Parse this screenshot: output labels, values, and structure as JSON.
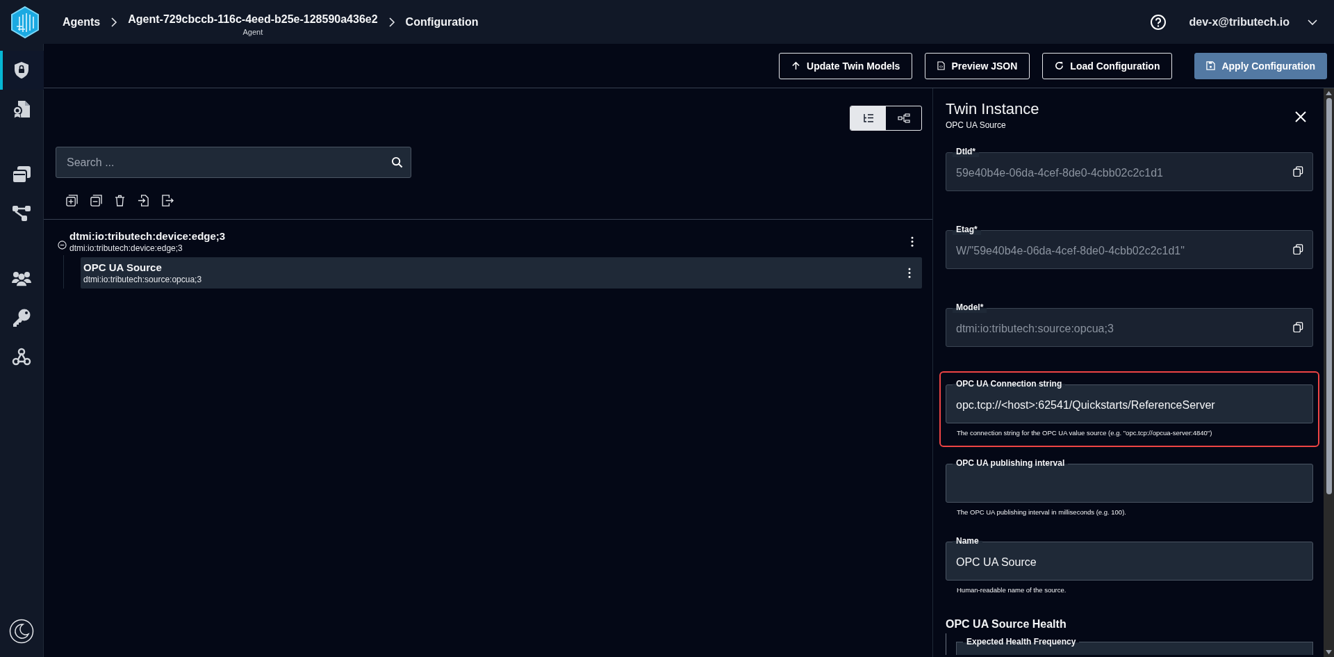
{
  "header": {
    "breadcrumbs": [
      {
        "label": "Agents"
      },
      {
        "label": "Agent-729cbccb-116c-4eed-b25e-128590a436e2",
        "sublabel": "Agent"
      },
      {
        "label": "Configuration"
      }
    ],
    "user": "dev-x@tributech.io"
  },
  "sidebar": {
    "items": [
      {
        "kind": "shield-lock",
        "selected": true
      },
      {
        "kind": "certificate",
        "selected": false
      },
      {
        "kind": "windows",
        "selected": false
      },
      {
        "kind": "hierarchy",
        "selected": false
      },
      {
        "kind": "users",
        "selected": false
      },
      {
        "kind": "key",
        "selected": false
      },
      {
        "kind": "webhook",
        "selected": false
      }
    ]
  },
  "toolbar": {
    "buttons": [
      {
        "label": "Update Twin Models",
        "kind": "upload",
        "primary": false
      },
      {
        "label": "Preview JSON",
        "kind": "file-code",
        "primary": false
      },
      {
        "label": "Load Configuration",
        "kind": "reload",
        "primary": false
      },
      {
        "label": "Apply Configuration",
        "kind": "save",
        "primary": true
      }
    ]
  },
  "view_toggle": [
    {
      "kind": "tree",
      "selected": true
    },
    {
      "kind": "diagram",
      "selected": false
    }
  ],
  "search": {
    "placeholder": "Search ..."
  },
  "tree_actions": [
    {
      "kind": "expand-all"
    },
    {
      "kind": "collapse-all"
    },
    {
      "kind": "delete"
    },
    {
      "kind": "import"
    },
    {
      "kind": "export"
    }
  ],
  "tree": [
    {
      "title": "dtmi:io:tributech:device:edge;3",
      "subtitle": "dtmi:io:tributech:device:edge;3",
      "expanded": true,
      "selected": false,
      "children": [
        {
          "title": "OPC UA Source",
          "subtitle": "dtmi:io:tributech:source:opcua;3",
          "selected": true
        }
      ]
    }
  ],
  "panel": {
    "title": "Twin Instance",
    "subtitle": "OPC UA Source",
    "fields": [
      {
        "label": "DtId*",
        "value": "59e40b4e-06da-4cef-8de0-4cbb02c2c1d1",
        "readonly": true,
        "copyable": true,
        "highlighted": false
      },
      {
        "label": "Etag*",
        "value": "W/\"59e40b4e-06da-4cef-8de0-4cbb02c2c1d1\"",
        "readonly": true,
        "copyable": true,
        "highlighted": false
      },
      {
        "label": "Model*",
        "value": "dtmi:io:tributech:source:opcua;3",
        "readonly": true,
        "copyable": true,
        "highlighted": false
      },
      {
        "label": "OPC UA Connection string",
        "value": "opc.tcp://<host>:62541/Quickstarts/ReferenceServer",
        "readonly": false,
        "copyable": false,
        "highlighted": true,
        "hint": "The connection string for the OPC UA value source (e.g. \"opc.tcp://opcua-server:4840\")"
      },
      {
        "label": "OPC UA publishing interval",
        "readonly": false,
        "copyable": false,
        "highlighted": false,
        "hint": "The OPC UA publishing interval in milliseconds (e.g. 100)."
      },
      {
        "label": "Name",
        "value": "OPC UA Source",
        "readonly": false,
        "copyable": false,
        "highlighted": false,
        "hint": "Human-readable name of the source."
      }
    ],
    "section": {
      "title": "OPC UA Source Health",
      "fields": [
        {
          "label": "Expected Health Frequency"
        }
      ]
    }
  }
}
